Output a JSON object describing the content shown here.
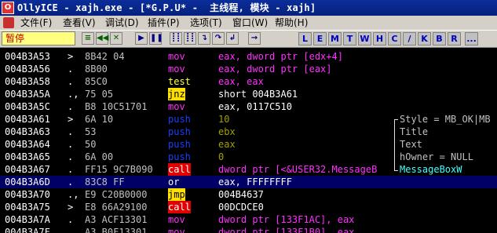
{
  "title_bar": {
    "icon_letter": "O",
    "text": "OllyICE - xajh.exe - [*G.P.U* -  主线程, 模块 - xajh]"
  },
  "menu": [
    {
      "label": "文件(F)"
    },
    {
      "label": "查看(V)"
    },
    {
      "label": "调试(D)"
    },
    {
      "label": "插件(P)"
    },
    {
      "label": "选项(T)"
    },
    {
      "label": "窗口(W)"
    },
    {
      "label": "帮助(H)"
    }
  ],
  "toolbar": {
    "status": "暂停",
    "buttons": [
      "≡",
      "◀◀",
      "✕",
      "▶",
      "❚❚",
      "┋┋",
      "┋┋",
      "↴",
      "↷",
      "↲",
      "→"
    ],
    "letters": [
      "L",
      "E",
      "M",
      "T",
      "W",
      "H",
      "C",
      "/",
      "K",
      "B",
      "R",
      "..."
    ]
  },
  "disasm": {
    "rows": [
      {
        "addr": "004B3A53",
        "mark": ">",
        "hex": "8B42 04",
        "mnem": "mov",
        "mnem_class": "c-mov",
        "op": "eax, dword ptr [edx+4]",
        "op_class": "o-mag"
      },
      {
        "addr": "004B3A56",
        "mark": ".",
        "hex": "8B00",
        "mnem": "mov",
        "mnem_class": "c-mov",
        "op": "eax, dword ptr [eax]",
        "op_class": "o-mag"
      },
      {
        "addr": "004B3A58",
        "mark": ".",
        "hex": "85C0",
        "mnem": "test",
        "mnem_class": "c-test",
        "op": "eax, eax",
        "op_class": "o-mag"
      },
      {
        "addr": "004B3A5A",
        "mark": ".,",
        "hex": "75 05",
        "mnem": "jnz",
        "mnem_class": "c-jcc",
        "op": "short 004B3A61",
        "op_class": "o-white"
      },
      {
        "addr": "004B3A5C",
        "mark": ".",
        "hex": "B8 10C51701",
        "mnem": "mov",
        "mnem_class": "c-mov",
        "op": "eax, 0117C510",
        "op_class": "o-white"
      },
      {
        "addr": "004B3A61",
        "mark": ">",
        "hex": "6A 10",
        "mnem": "push",
        "mnem_class": "c-push",
        "op": "10",
        "op_class": "o-olive"
      },
      {
        "addr": "004B3A63",
        "mark": ".",
        "hex": "53",
        "mnem": "push",
        "mnem_class": "c-push",
        "op": "ebx",
        "op_class": "o-olive"
      },
      {
        "addr": "004B3A64",
        "mark": ".",
        "hex": "50",
        "mnem": "push",
        "mnem_class": "c-push",
        "op": "eax",
        "op_class": "o-olive"
      },
      {
        "addr": "004B3A65",
        "mark": ".",
        "hex": "6A 00",
        "mnem": "push",
        "mnem_class": "c-push",
        "op": "0",
        "op_class": "o-olive"
      },
      {
        "addr": "004B3A67",
        "mark": ".",
        "hex": "FF15 9C7B090",
        "mnem": "call",
        "mnem_class": "c-call",
        "op": "dword ptr [<&USER32.MessageB",
        "op_class": "o-mag"
      },
      {
        "addr": "004B3A6D",
        "mark": ".",
        "hex": "83C8 FF",
        "mnem": "or",
        "mnem_class": "c-or",
        "op": "eax, FFFFFFFF",
        "op_class": "o-white",
        "selected": true
      },
      {
        "addr": "004B3A70",
        "mark": ".,",
        "hex": "E9 C20B0000",
        "mnem": "jmp",
        "mnem_class": "c-jmp",
        "op": "004B4637",
        "op_class": "o-white"
      },
      {
        "addr": "004B3A75",
        "mark": ">",
        "hex": "E8 66A29100",
        "mnem": "call",
        "mnem_class": "c-call",
        "op": "00DCDCE0",
        "op_class": "o-white"
      },
      {
        "addr": "004B3A7A",
        "mark": ".",
        "hex": "A3 ACF13301",
        "mnem": "mov",
        "mnem_class": "c-mov",
        "op": "dword ptr [133F1AC], eax",
        "op_class": "o-mag"
      },
      {
        "addr": "004B3A7F",
        "mark": ".",
        "hex": "A3 B0F13301",
        "mnem": "mov",
        "mnem_class": "c-mov",
        "op": "dword ptr [133F1B0], eax",
        "op_class": "o-mag"
      }
    ]
  },
  "comment_box": {
    "lines": [
      "Style = MB_OK|MB",
      "Title",
      "Text",
      "hOwner = NULL",
      "MessageBoxW"
    ]
  },
  "colors": {
    "background": "#000000",
    "selection": "#000066",
    "mnemonic_mov": "#ff30ff",
    "mnemonic_push": "#1e3cff",
    "call_bg": "#e00000",
    "jump_bg": "#ffe000"
  }
}
